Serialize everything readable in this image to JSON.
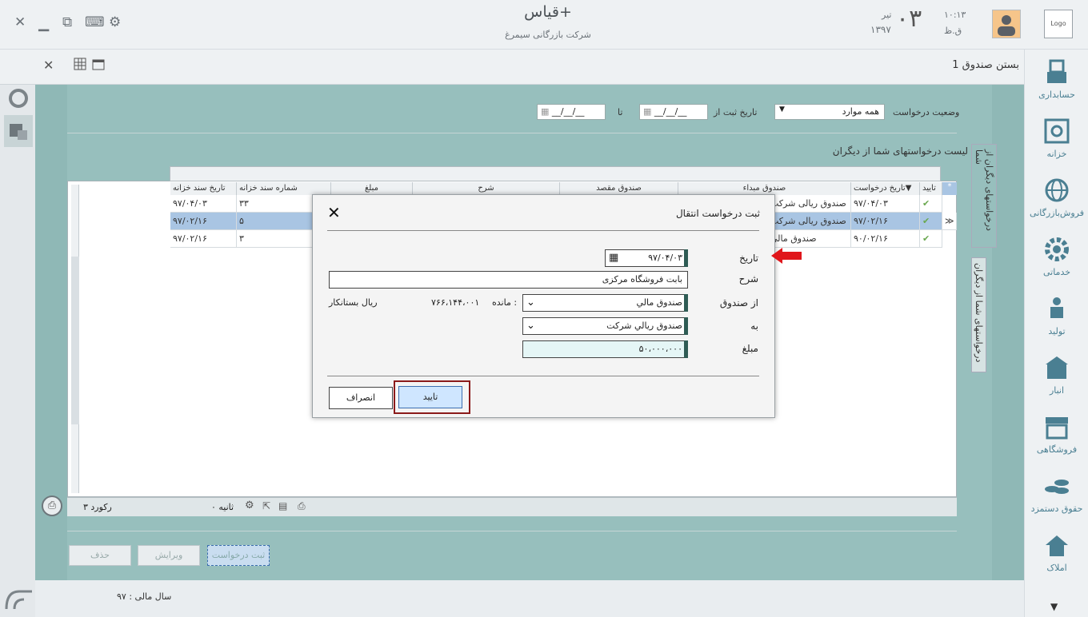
{
  "header": {
    "app_title": "قیاس+",
    "company": "شرکت بازرگانی سیمرغ",
    "time": "۱۰:۱۳",
    "meridiem": "ق.ظ",
    "day": "۰۳",
    "month": "تیر",
    "year": "۱۳۹۷",
    "logo": "Logo"
  },
  "subbar": {
    "page_title": "بستن صندوق 1"
  },
  "filters": {
    "status_label": "وضعیت درخواست",
    "status_value": "همه موارد",
    "date_from_label": "تاریخ ثبت از",
    "date_to_label": "تا",
    "date_from_value": "__/__/__",
    "date_to_value": "__/__/__"
  },
  "list": {
    "title": "لیست درخواستهای شما از دیگران",
    "columns": [
      "تایید",
      "تاریخ درخواست",
      "صندوق مبداء",
      "صندوق مقصد",
      "شرح",
      "مبلغ",
      "شماره سند خزانه",
      "تاریخ سند خزانه"
    ],
    "rows": [
      {
        "date": "۹۷/۰۴/۰۳",
        "source": "صندوق ریالی شرکت",
        "doc_no": "۳۳",
        "doc_date": "۹۷/۰۴/۰۳"
      },
      {
        "date": "۹۷/۰۲/۱۶",
        "source": "صندوق ریالی شرکت",
        "doc_no": "۵",
        "doc_date": "۹۷/۰۲/۱۶"
      },
      {
        "date": "۹۰/۰۲/۱۶",
        "source": "صندوق مالی",
        "doc_no": "۳",
        "doc_date": "۹۷/۰۲/۱۶"
      }
    ],
    "record_count": "۳ رکورد",
    "seconds": "۰ ثانیه"
  },
  "side_tabs": {
    "tab1": "درخواستهای دیگران از شما",
    "tab2": "درخواستهای شما از دیگران"
  },
  "bottom_buttons": {
    "new": "ثبت درخواست",
    "edit": "ویرایش",
    "delete": "حذف"
  },
  "footer": {
    "fiscal_year": "سال مالی : ۹۷"
  },
  "right_nav": [
    {
      "label": "حسابداری",
      "icon": "accounting-icon"
    },
    {
      "label": "خزانه",
      "icon": "safe-icon"
    },
    {
      "label": "فروش‌بازرگانی",
      "icon": "globe-icon"
    },
    {
      "label": "خدماتی",
      "icon": "gear-icon"
    },
    {
      "label": "تولید",
      "icon": "worker-icon"
    },
    {
      "label": "انبار",
      "icon": "warehouse-icon"
    },
    {
      "label": "فروشگاهی",
      "icon": "shop-icon"
    },
    {
      "label": "حقوق دستمزد",
      "icon": "coins-icon"
    },
    {
      "label": "املاک",
      "icon": "house-icon"
    }
  ],
  "dialog": {
    "title": "ثبت درخواست انتقال",
    "date_label": "تاریخ",
    "date_value": "۹۷/۰۴/۰۳",
    "desc_label": "شرح",
    "desc_value": "بابت فروشگاه مرکزی",
    "from_label": "از صندوق",
    "from_value": "صندوق مالي",
    "balance_label": "مانده :",
    "balance_value": "۷۶۶،۱۴۴،۰۰۱",
    "balance_status": "ریال بستانکار",
    "to_label": "به",
    "to_value": "صندوق ريالي شرکت",
    "amount_label": "مبلغ",
    "amount_value": "۵۰،۰۰۰،۰۰۰",
    "ok_label": "تایید",
    "cancel_label": "انصراف"
  },
  "colors": {
    "accent": "#4a7f92",
    "pane": "#97bfbd",
    "ok_frame": "#8b1a1a",
    "arrow": "#e0161b"
  }
}
